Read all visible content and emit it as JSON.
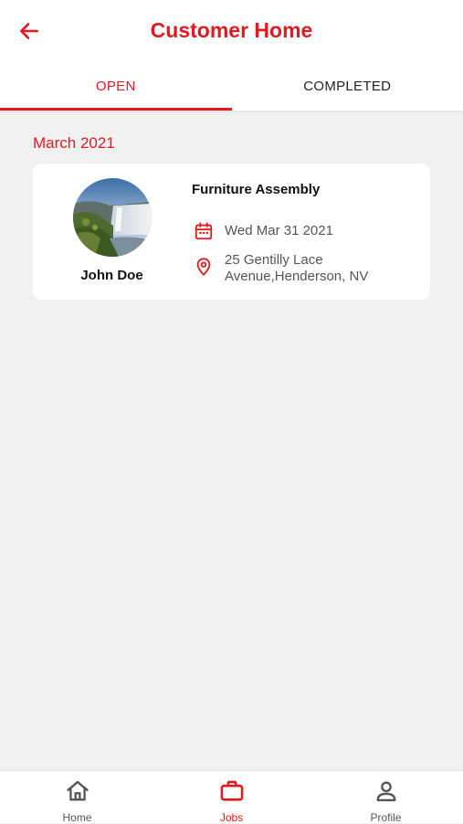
{
  "header": {
    "title": "Customer Home",
    "back_icon": "arrow-left-icon"
  },
  "tabs": [
    {
      "label": "OPEN",
      "active": true
    },
    {
      "label": "COMPLETED",
      "active": false
    }
  ],
  "section": {
    "month": "March 2021"
  },
  "job_card": {
    "customer_name": "John Doe",
    "job_title": "Furniture Assembly",
    "date": "Wed Mar 31 2021",
    "address_line1": "25 Gentilly Lace",
    "address_line2": "Avenue,Henderson, NV",
    "date_icon": "calendar-icon",
    "location_icon": "location-pin-icon",
    "avatar": "waterfall-photo"
  },
  "bottom_nav": [
    {
      "label": "Home",
      "icon": "home-icon",
      "active": false
    },
    {
      "label": "Jobs",
      "icon": "briefcase-icon",
      "active": true
    },
    {
      "label": "Profile",
      "icon": "person-icon",
      "active": false
    }
  ],
  "colors": {
    "accent": "#e3191f",
    "background": "#f1f1f1",
    "card": "#ffffff",
    "nav_inactive": "#555555"
  }
}
